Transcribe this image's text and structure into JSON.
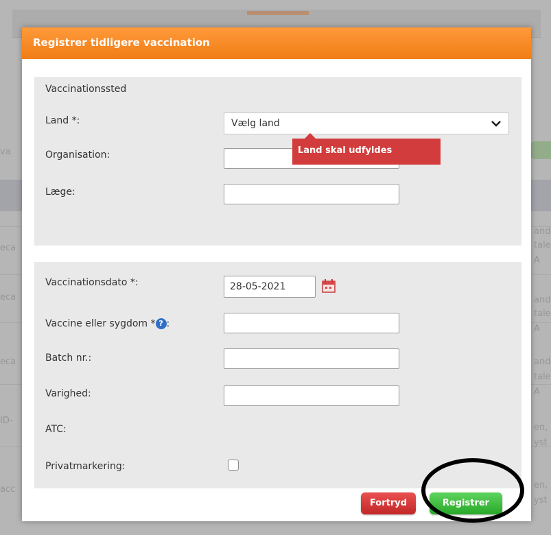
{
  "background_page": {
    "side_fragments": [
      "va",
      "eca",
      "eca",
      "eca",
      "ID-",
      "acc"
    ],
    "right_fragments": [
      "and",
      "tale",
      "A",
      "and",
      "tale",
      "A",
      "and",
      "tale",
      "A",
      "en,",
      "yst",
      "en,",
      "yst"
    ]
  },
  "dialog": {
    "title": "Registrer tidligere vaccination",
    "section1": {
      "title": "Vaccinationssted",
      "land_label": "Land *:",
      "land_value": "Vælg land",
      "land_error": "Land skal udfyldes",
      "organisation_label": "Organisation:",
      "laege_label": "Læge:"
    },
    "section2": {
      "date_label": "Vaccinationsdato *:",
      "date_value": "28-05-2021",
      "vaccine_label": "Vaccine eller sygdom *",
      "vaccine_label_suffix": ":",
      "help_glyph": "?",
      "batch_label": "Batch nr.:",
      "duration_label": "Varighed:",
      "atc_label": "ATC:",
      "private_label": "Privatmarkering:"
    },
    "buttons": {
      "cancel": "Fortryd",
      "register": "Registrer"
    }
  },
  "colors": {
    "header_orange": "#f7891f",
    "error_red": "#d23c3c",
    "register_green": "#2fb12f",
    "cancel_red": "#d53a3a"
  },
  "icons": [
    "chevron-down-icon",
    "calendar-icon",
    "help-icon"
  ]
}
